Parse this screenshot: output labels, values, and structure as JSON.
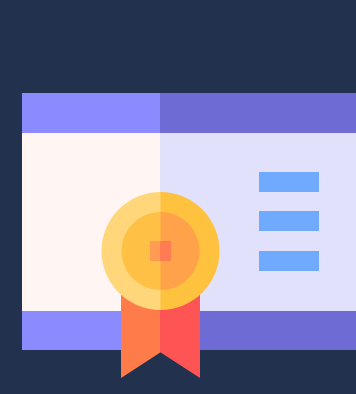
{
  "colors": {
    "background": "#22314D",
    "frame_left": "#8C8AFF",
    "frame_right": "#6F6BD4",
    "paper_left": "#FFF5F3",
    "paper_right": "#E1E1FC",
    "text_lines": "#70AAFF",
    "ribbon_left": "#FF7C4A",
    "ribbon_right": "#FF5454",
    "medal_outer_left": "#FFD77A",
    "medal_outer_right": "#FFC23F",
    "medal_inner_left": "#FFC145",
    "medal_inner_right": "#FFA249",
    "medal_center_left": "#FF9B52",
    "medal_center_right": "#FF7B52"
  },
  "icons": {
    "certificate": "certificate-icon",
    "medal": "award-medal-icon"
  }
}
